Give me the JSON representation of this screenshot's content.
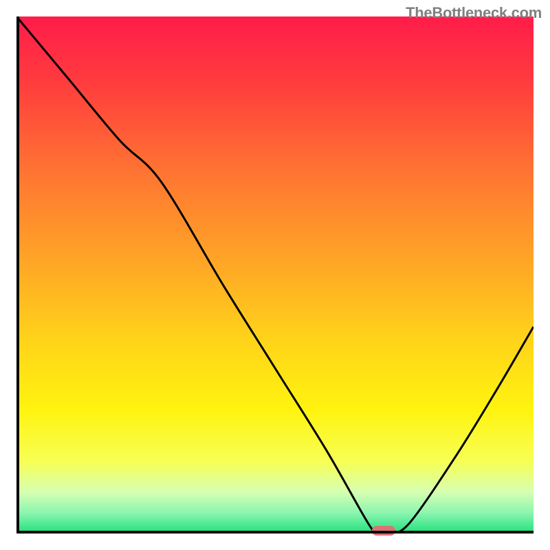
{
  "watermark": "TheBottleneck.com",
  "chart_data": {
    "type": "line",
    "title": "",
    "xlabel": "",
    "ylabel": "",
    "x_range": [
      0,
      100
    ],
    "y_range": [
      0,
      100
    ],
    "series": [
      {
        "name": "bottleneck-curve",
        "x": [
          0,
          10,
          20,
          28,
          40,
          50,
          60,
          68,
          70,
          72,
          76,
          85,
          93,
          100
        ],
        "y": [
          100,
          88,
          76,
          68,
          48,
          32,
          16,
          2,
          0,
          0,
          2,
          15,
          28,
          40
        ]
      }
    ],
    "marker": {
      "name": "optimal-point",
      "x": 71,
      "y": 0,
      "color": "#dd7171"
    },
    "background_gradient": {
      "stops": [
        {
          "offset": 0.0,
          "color": "#ff1c4a"
        },
        {
          "offset": 0.12,
          "color": "#ff3a3e"
        },
        {
          "offset": 0.3,
          "color": "#ff7432"
        },
        {
          "offset": 0.48,
          "color": "#ffa726"
        },
        {
          "offset": 0.62,
          "color": "#ffd21a"
        },
        {
          "offset": 0.76,
          "color": "#fff30f"
        },
        {
          "offset": 0.86,
          "color": "#f7ff54"
        },
        {
          "offset": 0.92,
          "color": "#d6ffb2"
        },
        {
          "offset": 0.96,
          "color": "#8cf5b0"
        },
        {
          "offset": 1.0,
          "color": "#1ee07a"
        }
      ]
    },
    "line_color": "#000000",
    "line_width": 3
  }
}
